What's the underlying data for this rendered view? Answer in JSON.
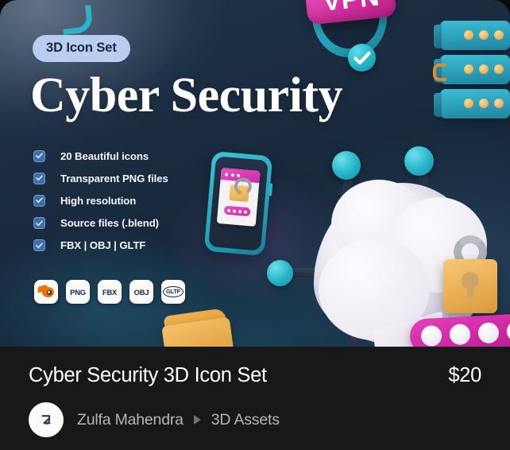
{
  "hero": {
    "badge_label": "3D Icon Set",
    "title": "Cyber Security",
    "features": [
      {
        "label": "20 Beautiful icons",
        "icon": "checkbox-checked-icon"
      },
      {
        "label": "Transparent PNG files",
        "icon": "checkbox-checked-icon"
      },
      {
        "label": "High resolution",
        "icon": "checkbox-checked-icon"
      },
      {
        "label": "Source files (.blend)",
        "icon": "checkbox-checked-icon"
      },
      {
        "label": "FBX | OBJ | GLTF",
        "icon": "checkbox-checked-icon"
      }
    ],
    "format_chips": [
      {
        "label": "",
        "icon": "blender-logo-icon"
      },
      {
        "label": "PNG",
        "icon": "png-format-icon"
      },
      {
        "label": "FBX",
        "icon": "fbx-format-icon"
      },
      {
        "label": "OBJ",
        "icon": "obj-format-icon"
      },
      {
        "label": "GLTF",
        "icon": "gltf-format-icon"
      }
    ],
    "artwork": {
      "vpn_badge_label": "VPN",
      "elements": [
        "vpn-shield-3d-icon",
        "server-rack-3d-icon",
        "smartphone-lock-3d-icon",
        "cloud-network-3d-icon",
        "padlock-3d-icon",
        "folder-cable-3d-icon",
        "magenta-pill-3d-icon"
      ]
    },
    "colors": {
      "background_dark": "#16273a",
      "badge_bg": "#b9cdf0",
      "badge_text": "#17263a",
      "teal": "#2fa6c0",
      "magenta": "#cf2aa4",
      "orange": "#ea7600",
      "gold": "#ebb157",
      "checkbox": "#3e6fa8"
    }
  },
  "info": {
    "title": "Cyber Security 3D Icon Set",
    "price": "$20",
    "author": "Zulfa Mahendra",
    "category": "3D Assets",
    "separator_icon": "triangle-right-icon",
    "avatar_icon": "author-avatar-monogram-icon",
    "colors": {
      "panel_bg": "#181818",
      "title_text": "#ffffff",
      "meta_text": "#b6b6b6"
    }
  }
}
